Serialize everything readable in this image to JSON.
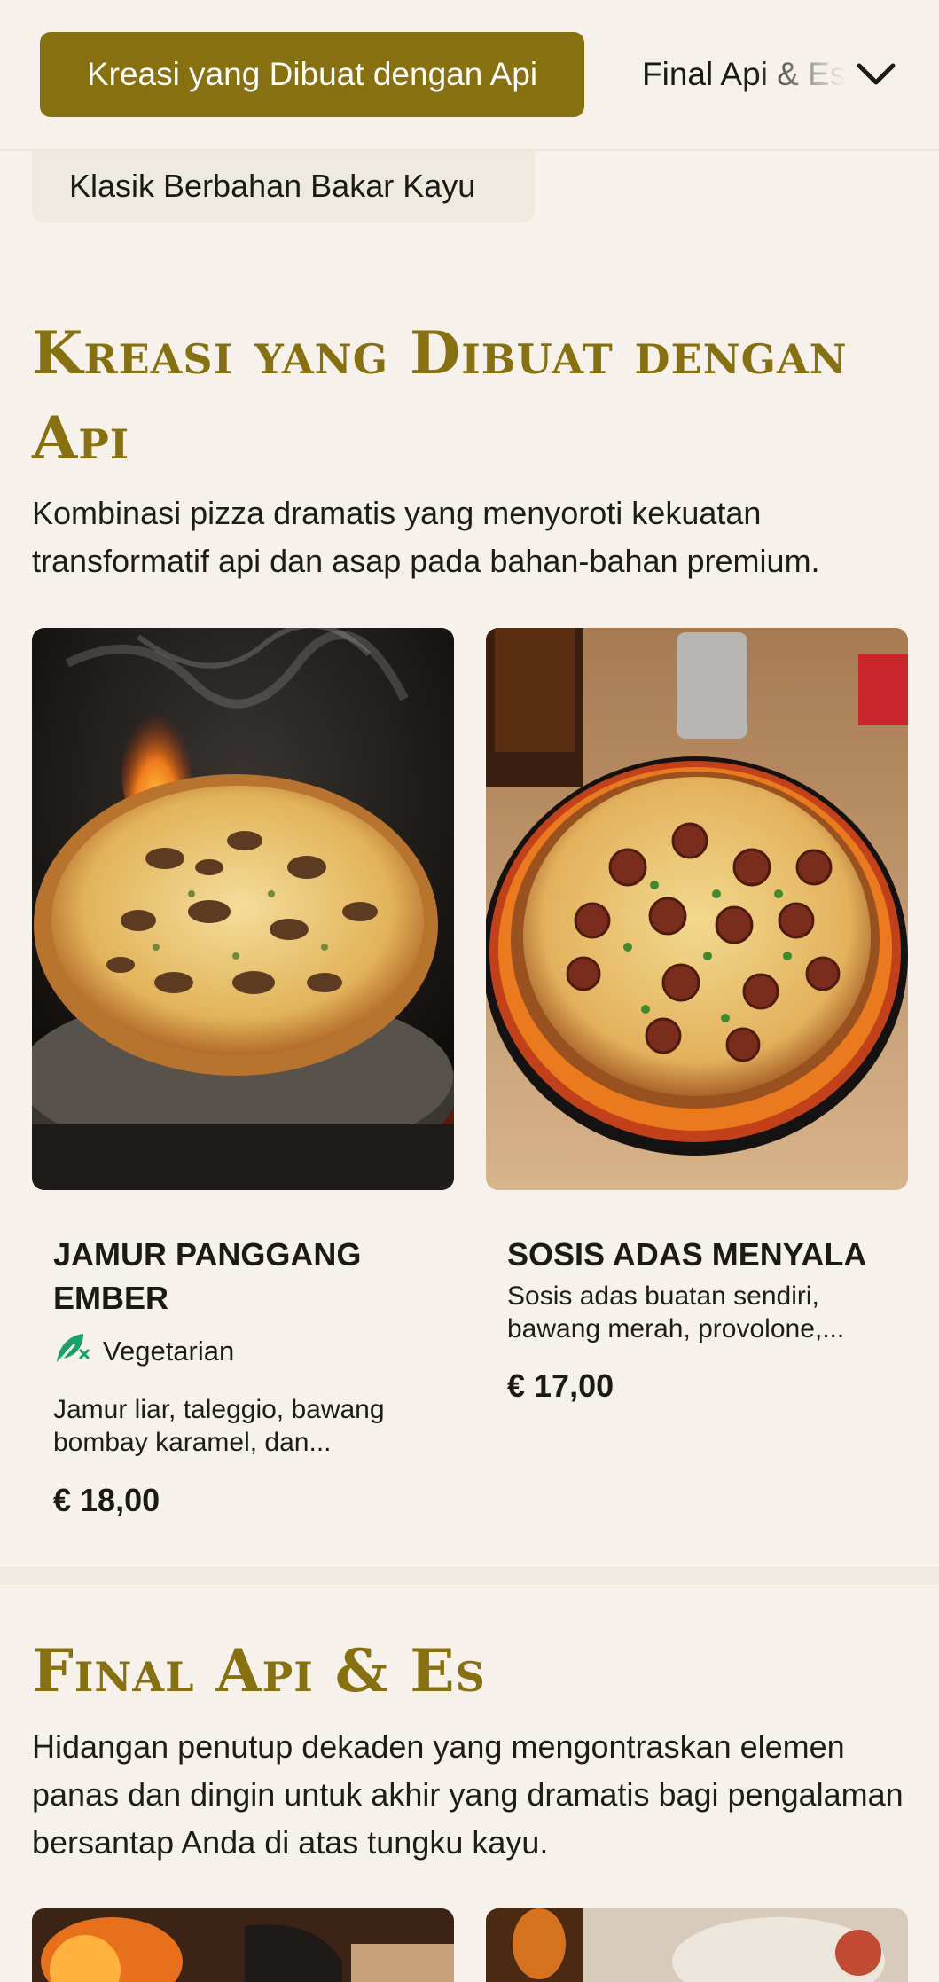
{
  "category_nav": {
    "active": "Kreasi yang Dibuat dengan Api",
    "next": "Final Api & Es",
    "previous": "Klasik Berbahan Bakar Kayu"
  },
  "sections": [
    {
      "title": "Kreasi yang Dibuat dengan Api",
      "description": "Kombinasi pizza dramatis yang menyoroti kekuatan transformatif api dan asap pada bahan-bahan premium.",
      "items": [
        {
          "name": "JAMUR PANGGANG EMBER",
          "badge": "Vegetarian",
          "description": "Jamur liar, taleggio, bawang bombay karamel, dan...",
          "price": "€ 18,00"
        },
        {
          "name": "SOSIS ADAS MENYALA",
          "description": "Sosis adas buatan sendiri, bawang merah, provolone,...",
          "price": "€ 17,00"
        }
      ]
    },
    {
      "title": "Final Api & Es",
      "description": "Hidangan penutup dekaden yang mengontraskan elemen panas dan dingin untuk akhir yang dramatis bagi pengalaman bersantap Anda di atas tungku kayu."
    }
  ],
  "colors": {
    "background": "#f6f2eb",
    "accent": "#86700f",
    "vegetarian_icon": "#1aa06a"
  },
  "icons": {
    "chevron": "chevron-down-icon",
    "vegetarian": "vegetarian-leaf-icon"
  }
}
